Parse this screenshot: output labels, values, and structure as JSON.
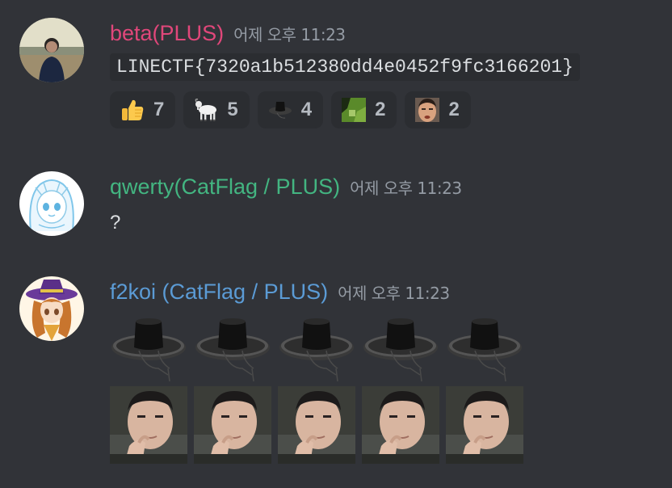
{
  "messages": [
    {
      "author": "beta(PLUS)",
      "author_color": "#e0477a",
      "timestamp": "어제 오후 11:23",
      "content": "LINECTF{7320a1b512380dd4e0452f9fc3166201}",
      "reactions": [
        {
          "emoji": "thumbs-up-icon",
          "count": "7"
        },
        {
          "emoji": "goat-icon",
          "count": "5"
        },
        {
          "emoji": "black-hat-icon",
          "count": "4"
        },
        {
          "emoji": "green-image-icon",
          "count": "2"
        },
        {
          "emoji": "face-icon",
          "count": "2"
        }
      ]
    },
    {
      "author": "qwerty(CatFlag / PLUS)",
      "author_color": "#43b581",
      "timestamp": "어제 오후 11:23",
      "content": "?"
    },
    {
      "author": "f2koi (CatFlag / PLUS)",
      "author_color": "#5b9bd5",
      "timestamp": "어제 오후 11:23",
      "stickers": {
        "row1": [
          "gat-hat-emoji",
          "gat-hat-emoji",
          "gat-hat-emoji",
          "gat-hat-emoji",
          "gat-hat-emoji"
        ],
        "row2": [
          "thinking-face-emoji",
          "thinking-face-emoji",
          "thinking-face-emoji",
          "thinking-face-emoji",
          "thinking-face-emoji"
        ]
      }
    }
  ]
}
